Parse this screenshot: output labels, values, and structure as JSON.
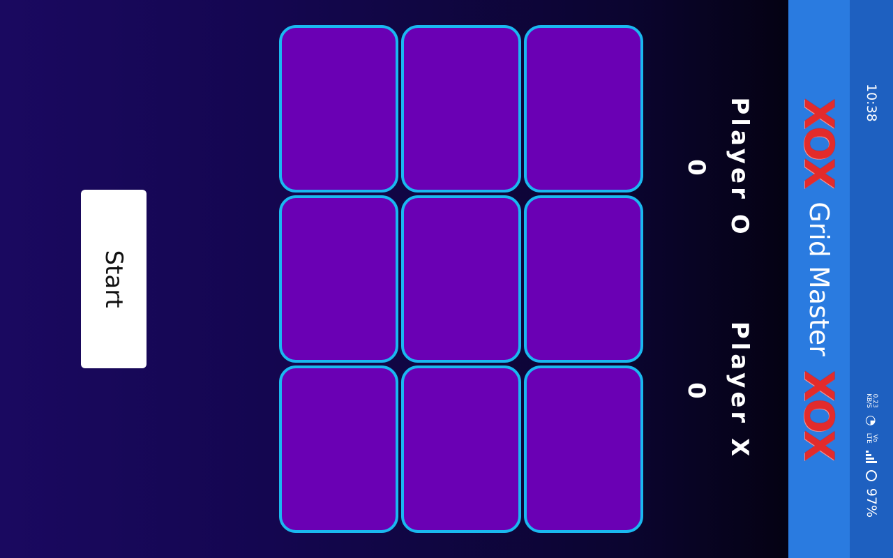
{
  "status_bar": {
    "time": "10:38",
    "net_speed_value": "0.23",
    "net_speed_unit": "KB/S",
    "network_type_top": "Vo",
    "network_type_bottom": "LTE",
    "battery": "97%",
    "icons": [
      "wifi-icon",
      "signal-icon",
      "battery-icon"
    ]
  },
  "header": {
    "logo_left": "XOX",
    "title": "Grid Master",
    "logo_right": "XOX"
  },
  "scoreboard": {
    "player_o": {
      "name": "Player O",
      "score": "0"
    },
    "player_x": {
      "name": "Player X",
      "score": "0"
    }
  },
  "board": {
    "cells": [
      "",
      "",
      "",
      "",
      "",
      "",
      "",
      "",
      ""
    ]
  },
  "controls": {
    "start_label": "Start"
  },
  "colors": {
    "cell_fill": "#6a00b4",
    "cell_border": "#1ab8f0",
    "title_bar": "#2a7be0",
    "status_bar": "#1e60c0",
    "logo": "#e32b2b"
  }
}
